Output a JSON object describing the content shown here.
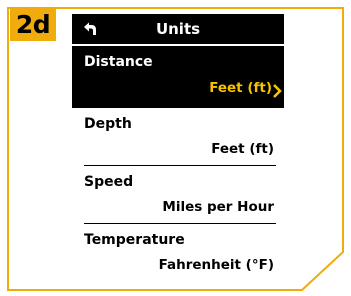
{
  "step_badge": "2d",
  "screen": {
    "title": "Units",
    "back_icon": "back-arrow-icon",
    "selected_chevron_icon": "chevron-right-icon"
  },
  "settings": [
    {
      "label": "Distance",
      "value": "Feet (ft)",
      "selected": true
    },
    {
      "label": "Depth",
      "value": "Feet (ft)",
      "selected": false
    },
    {
      "label": "Speed",
      "value": "Miles per Hour",
      "selected": false
    },
    {
      "label": "Temperature",
      "value": "Fahrenheit (°F)",
      "selected": false
    }
  ],
  "colors": {
    "badge": "#f0ab0c",
    "frame_outline": "#f0ab0c",
    "highlight_text": "#f5c400",
    "screen_bg": "#ffffff",
    "selected_row_bg": "#000000"
  }
}
